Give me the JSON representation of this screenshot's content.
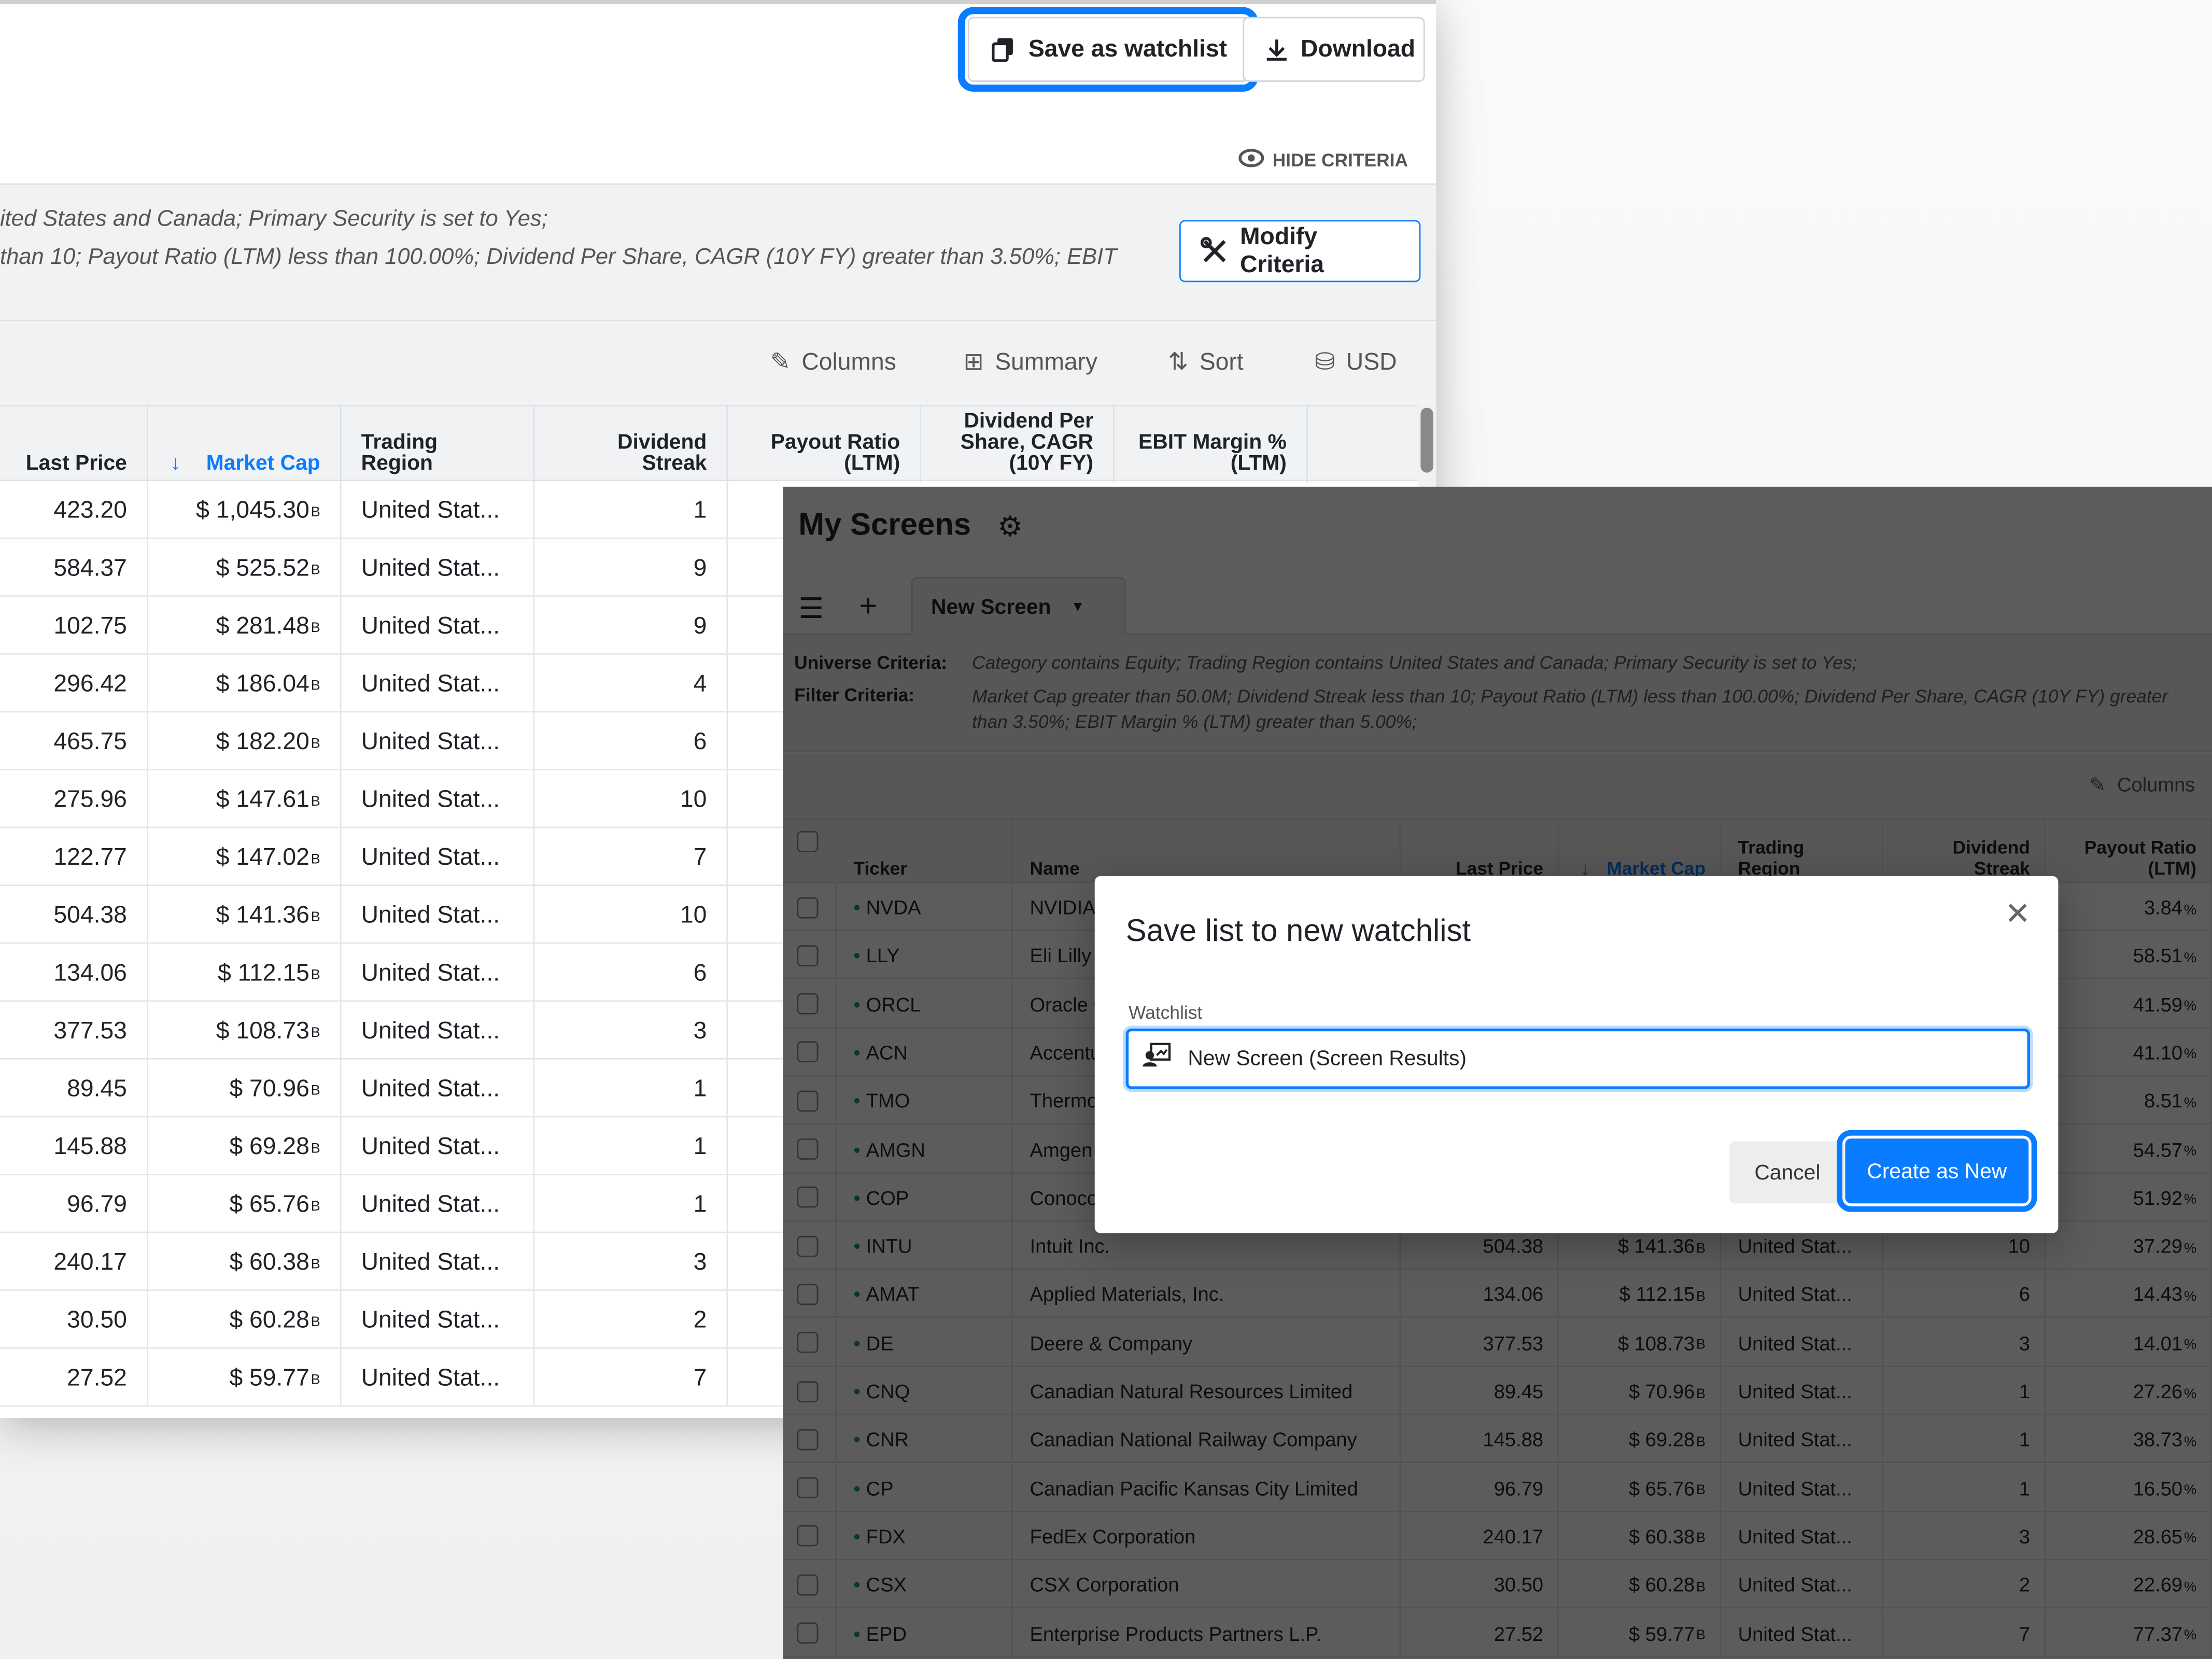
{
  "top_actions": {
    "save_watchlist": "Save as watchlist",
    "download": "Download",
    "hide_criteria": "HIDE CRITERIA"
  },
  "criteria_left": {
    "line1": "ited States and Canada; Primary Security is set to Yes;",
    "line2": "than 10; Payout Ratio (LTM) less than 100.00%; Dividend Per Share, CAGR (10Y FY) greater than 3.50%; EBIT",
    "modify": "Modify Criteria"
  },
  "toolbar": {
    "columns": "Columns",
    "summary": "Summary",
    "sort": "Sort",
    "currency": "USD"
  },
  "left_headers": {
    "last_price": "Last Price",
    "market_cap": "Market Cap",
    "trading_region": "Trading Region",
    "dividend_streak": "Dividend Streak",
    "payout_ratio": "Payout Ratio (LTM)",
    "dps_cagr": "Dividend Per Share, CAGR (10Y FY)",
    "ebit_margin": "EBIT Margin % (LTM)"
  },
  "unit_suffix": "B",
  "percent_suffix": "%",
  "rows": [
    {
      "ticker": "NVDA",
      "name": "NVIDIA Corporation",
      "last": "423.20",
      "mcap": "$ 1,045.30",
      "region": "United Stat...",
      "streak": "1",
      "payout": "3.84"
    },
    {
      "ticker": "LLY",
      "name": "Eli Lilly and Company",
      "last": "584.37",
      "mcap": "$ 525.52",
      "region": "United Stat...",
      "streak": "9",
      "payout": "58.51"
    },
    {
      "ticker": "ORCL",
      "name": "Oracle Corporation",
      "last": "102.75",
      "mcap": "$ 281.48",
      "region": "United Stat...",
      "streak": "9",
      "payout": "41.59"
    },
    {
      "ticker": "ACN",
      "name": "Accenture plc",
      "last": "296.42",
      "mcap": "$ 186.04",
      "region": "United Stat...",
      "streak": "4",
      "payout": "41.10"
    },
    {
      "ticker": "TMO",
      "name": "Thermo Fisher Scientific Inc.",
      "last": "465.75",
      "mcap": "$ 182.20",
      "region": "United Stat...",
      "streak": "6",
      "payout": "8.51"
    },
    {
      "ticker": "AMGN",
      "name": "Amgen Inc.",
      "last": "275.96",
      "mcap": "$ 147.61",
      "region": "United Stat...",
      "streak": "10",
      "payout": "54.57"
    },
    {
      "ticker": "COP",
      "name": "ConocoPhillips",
      "last": "122.77",
      "mcap": "$ 147.02",
      "region": "United Stat...",
      "streak": "7",
      "payout": "51.92"
    },
    {
      "ticker": "INTU",
      "name": "Intuit Inc.",
      "last": "504.38",
      "mcap": "$ 141.36",
      "region": "United Stat...",
      "streak": "10",
      "payout": "37.29"
    },
    {
      "ticker": "AMAT",
      "name": "Applied Materials, Inc.",
      "last": "134.06",
      "mcap": "$ 112.15",
      "region": "United Stat...",
      "streak": "6",
      "payout": "14.43"
    },
    {
      "ticker": "DE",
      "name": "Deere & Company",
      "last": "377.53",
      "mcap": "$ 108.73",
      "region": "United Stat...",
      "streak": "3",
      "payout": "14.01"
    },
    {
      "ticker": "CNQ",
      "name": "Canadian Natural Resources Limited",
      "last": "89.45",
      "mcap": "$ 70.96",
      "region": "United Stat...",
      "streak": "1",
      "payout": "27.26"
    },
    {
      "ticker": "CNR",
      "name": "Canadian National Railway Company",
      "last": "145.88",
      "mcap": "$ 69.28",
      "region": "United Stat...",
      "streak": "1",
      "payout": "38.73"
    },
    {
      "ticker": "CP",
      "name": "Canadian Pacific Kansas City Limited",
      "last": "96.79",
      "mcap": "$ 65.76",
      "region": "United Stat...",
      "streak": "1",
      "payout": "16.50"
    },
    {
      "ticker": "FDX",
      "name": "FedEx Corporation",
      "last": "240.17",
      "mcap": "$ 60.38",
      "region": "United Stat...",
      "streak": "3",
      "payout": "28.65"
    },
    {
      "ticker": "CSX",
      "name": "CSX Corporation",
      "last": "30.50",
      "mcap": "$ 60.28",
      "region": "United Stat...",
      "streak": "2",
      "payout": "22.69"
    },
    {
      "ticker": "EPD",
      "name": "Enterprise Products Partners L.P.",
      "last": "27.52",
      "mcap": "$ 59.77",
      "region": "United Stat...",
      "streak": "7",
      "payout": "77.37"
    }
  ],
  "my_screens": {
    "title": "My Screens",
    "tab": "New Screen",
    "universe_label": "Universe Criteria:",
    "universe_text": "Category contains Equity; Trading Region contains United States and Canada; Primary Security is set to Yes;",
    "filter_label": "Filter Criteria:",
    "filter_text": "Market Cap greater than 50.0M; Dividend Streak less than 10; Payout Ratio (LTM) less than 100.00%; Dividend Per Share, CAGR (10Y FY) greater than 3.50%; EBIT Margin % (LTM) greater than 5.00%;",
    "columns": "Columns",
    "headers": {
      "ticker": "Ticker",
      "name": "Name",
      "last_price": "Last Price",
      "market_cap": "Market Cap",
      "trading_region": "Trading Region",
      "dividend_streak": "Dividend Streak",
      "payout_ratio": "Payout Ratio (LTM)"
    }
  },
  "modal": {
    "title": "Save list to new watchlist",
    "field_label": "Watchlist",
    "field_value": "New Screen (Screen Results)",
    "cancel": "Cancel",
    "create": "Create as New"
  },
  "colors": {
    "accent": "#0a7cff",
    "overlay": "#5a5a5a"
  }
}
